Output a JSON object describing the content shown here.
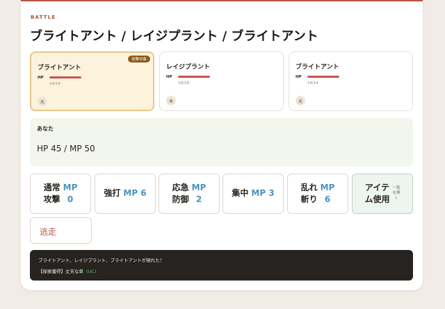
{
  "header": {
    "label": "BATTLE",
    "title": "ブライトアント / レイジプラント / ブライトアント"
  },
  "enemies": [
    {
      "name": "ブライトアント",
      "hp_label": "HP",
      "hp_text": "14/14",
      "hp_fraction": 1.0,
      "element": "光",
      "target_badge": "攻撃対象",
      "targeted": true
    },
    {
      "name": "レイジプラント",
      "hp_label": "HP",
      "hp_text": "18/18",
      "hp_fraction": 1.0,
      "element": "木",
      "targeted": false
    },
    {
      "name": "ブライトアント",
      "hp_label": "HP",
      "hp_text": "14/14",
      "hp_fraction": 1.0,
      "element": "光",
      "targeted": false
    }
  ],
  "player": {
    "name": "あなた",
    "stats": "HP 45 / MP 50"
  },
  "commands": [
    {
      "name": "通常\n攻撃",
      "mp": "MP\n0"
    },
    {
      "name": "強打",
      "mp": "MP 6"
    },
    {
      "name": "応急\n防御",
      "mp": "MP\n2"
    },
    {
      "name": "集中",
      "mp": "MP 3"
    },
    {
      "name": "乱れ\n斬り",
      "mp": "MP\n6"
    },
    {
      "name": "アイテ\nム使用",
      "hint": "一覧\nを開\nく"
    }
  ],
  "flee_label": "逃走",
  "log": {
    "line1": "ブライトアント、レイジプラント、ブライトアントが現れた！",
    "line2": "【探索獲得】丈夫な草",
    "line2_tag": "(UC)"
  },
  "colors": {
    "accent": "#a0552f",
    "hp_bar": "#c9534f",
    "mp_text": "#4a93c0",
    "target_badge": "#8b5a18",
    "log_bg": "#262320",
    "uc_tag": "#67c35a"
  }
}
